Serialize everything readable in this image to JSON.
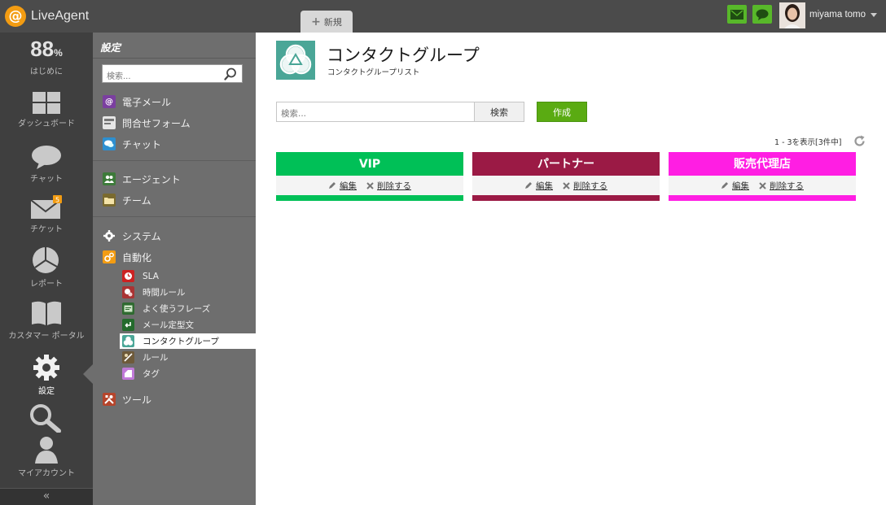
{
  "app": {
    "brand": "LiveAgent"
  },
  "topbar": {
    "new_tab_label": "新規",
    "user_name": "miyama tomo"
  },
  "left_nav": {
    "stats_value": "88",
    "stats_unit": "%",
    "items": [
      {
        "label": "はじめに",
        "icon": "progress-icon"
      },
      {
        "label": "ダッシュボード",
        "icon": "dashboard-icon"
      },
      {
        "label": "チャット",
        "icon": "chat-icon"
      },
      {
        "label": "チケット",
        "icon": "ticket-icon"
      },
      {
        "label": "レポート",
        "icon": "report-icon"
      },
      {
        "label": "カスタマー ポータル",
        "icon": "book-icon"
      },
      {
        "label": "設定",
        "icon": "gear-icon"
      },
      {
        "label": "",
        "icon": "search-icon"
      },
      {
        "label": "マイアカウント",
        "icon": "user-icon"
      }
    ],
    "collapse_glyph": "«"
  },
  "sidebar": {
    "title": "設定",
    "search_placeholder": "検索...",
    "groups": [
      {
        "label": "電子メール",
        "icon": "at-icon",
        "color": "#7b3fa0"
      },
      {
        "label": "問合せフォーム",
        "icon": "form-icon",
        "color": "#888888"
      },
      {
        "label": "チャット",
        "icon": "chat-icon",
        "color": "#2d8fd0"
      },
      {
        "label": "エージェント",
        "icon": "agents-icon",
        "color": "#3d7a3a"
      },
      {
        "label": "チーム",
        "icon": "folder-icon",
        "color": "#7a6a2f"
      },
      {
        "label": "システム",
        "icon": "gear-icon",
        "color": "#6e6e6e"
      },
      {
        "label": "自動化",
        "icon": "automation-icon",
        "color": "#f39c12"
      },
      {
        "label": "ツール",
        "icon": "tools-icon",
        "color": "#b5452c"
      }
    ],
    "automation_items": [
      {
        "label": "SLA",
        "icon": "clock-icon",
        "color": "#cc2222"
      },
      {
        "label": "時間ルール",
        "icon": "time-rule-icon",
        "color": "#aa3333"
      },
      {
        "label": "よく使うフレーズ",
        "icon": "phrase-icon",
        "color": "#2f6a30"
      },
      {
        "label": "メール定型文",
        "icon": "template-icon",
        "color": "#236b2c"
      },
      {
        "label": "コンタクトグループ",
        "icon": "contact-group-icon",
        "color": "#4aa697"
      },
      {
        "label": "ルール",
        "icon": "rule-icon",
        "color": "#6e5a3a"
      },
      {
        "label": "タグ",
        "icon": "tag-icon",
        "color": "#c07ad8"
      }
    ]
  },
  "main": {
    "title": "コンタクトグループ",
    "subtitle": "コンタクトグループリスト",
    "search_placeholder": "検索...",
    "search_button": "検索",
    "create_button": "作成",
    "result_count": "1 - 3を表示[3件中]",
    "edit_label": "編集",
    "delete_label": "削除する",
    "groups": [
      {
        "name": "VIP",
        "color": "#00c057"
      },
      {
        "name": "パートナー",
        "color": "#9b1a45"
      },
      {
        "name": "販売代理店",
        "color": "#ff1ee3"
      }
    ]
  }
}
